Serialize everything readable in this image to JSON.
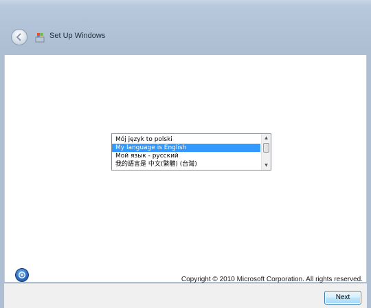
{
  "window": {
    "title": "Set Up Windows"
  },
  "language_list": {
    "items": [
      {
        "label": "Mój język to polski",
        "selected": false
      },
      {
        "label": "My language is English",
        "selected": true
      },
      {
        "label": "Мой язык - русский",
        "selected": false
      },
      {
        "label": "我的語言是 中文(繁體) (台灣)",
        "selected": false
      }
    ]
  },
  "footer": {
    "copyright": "Copyright © 2010 Microsoft Corporation.  All rights reserved."
  },
  "buttons": {
    "next_label": "Next"
  },
  "icons": {
    "back": "back-arrow-icon",
    "setup": "setup-windows-icon",
    "ease_of_access": "ease-of-access-icon"
  },
  "colors": {
    "selection": "#3399ff",
    "title_bar": "#b4c4d9"
  }
}
